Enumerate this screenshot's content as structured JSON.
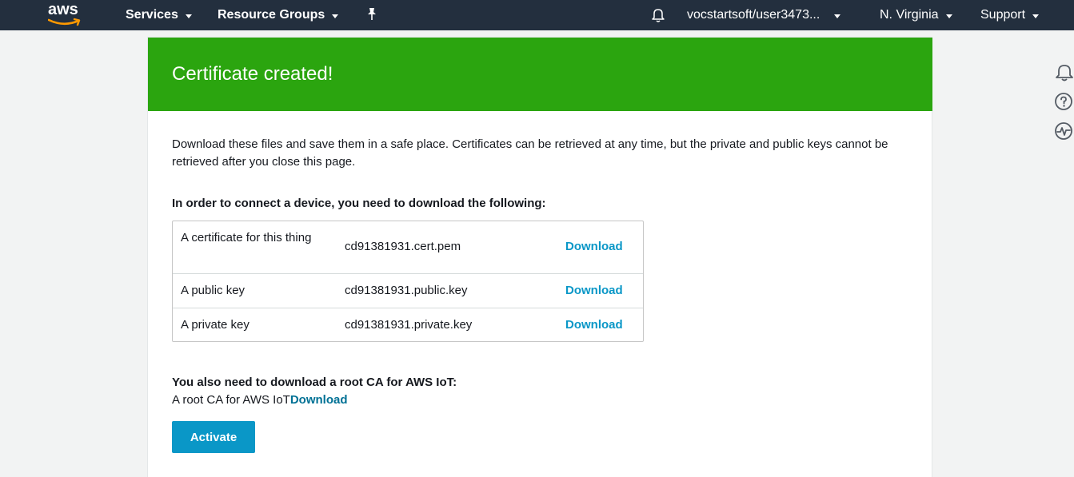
{
  "nav": {
    "logo_text": "aws",
    "services": "Services",
    "resource_groups": "Resource Groups",
    "account": "vocstartsoft/user3473...",
    "region": "N. Virginia",
    "support": "Support",
    "icons": [
      "pin-icon",
      "bell-icon"
    ]
  },
  "side_icons": [
    "bell-icon",
    "help-icon",
    "activity-icon"
  ],
  "banner": {
    "title": "Certificate created!",
    "color": "#2ba50f"
  },
  "intro": "Download these files and save them in a safe place. Certificates can be retrieved at any time, but the private and public keys cannot be retrieved after you close this page.",
  "required_heading": "In order to connect a device, you need to download the following:",
  "files": [
    {
      "description": "A certificate for this thing",
      "filename": "cd91381931.cert.pem",
      "action": "Download"
    },
    {
      "description": "A public key",
      "filename": "cd91381931.public.key",
      "action": "Download"
    },
    {
      "description": "A private key",
      "filename": "cd91381931.private.key",
      "action": "Download"
    }
  ],
  "root_ca": {
    "heading": "You also need to download a root CA for AWS IoT:",
    "label": "A root CA for AWS IoT",
    "action": "Download"
  },
  "activate_label": "Activate",
  "colors": {
    "nav_bg": "#232f3e",
    "link": "#0a97c7",
    "button": "#0a97c7",
    "aws_orange": "#ff9900"
  }
}
